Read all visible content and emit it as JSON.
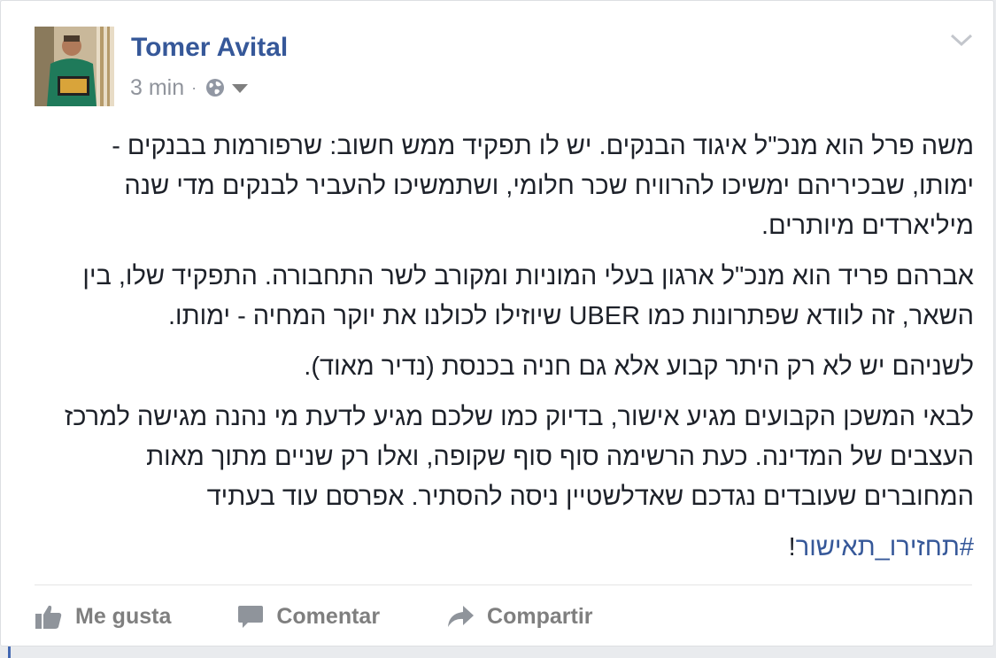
{
  "post": {
    "author": "Tomer Avital",
    "time": "3 min",
    "separator": "·",
    "paragraphs": [
      "משה פרל הוא מנכ\"ל איגוד הבנקים. יש לו תפקיד ממש חשוב: שרפורמות בבנקים - ימותו, שבכיריהם ימשיכו להרוויח שכר חלומי, ושתמשיכו להעביר לבנקים מדי שנה מיליארדים מיותרים.",
      "אברהם פריד הוא מנכ\"ל ארגון בעלי המוניות ומקורב לשר התחבורה. התפקיד שלו, בין השאר, זה לוודא שפתרונות כמו UBER שיוזילו לכולנו את יוקר המחיה - ימותו.",
      "לשניהם יש לא רק היתר קבוע אלא גם חניה בכנסת (נדיר מאוד).",
      "לבאי המשכן הקבועים מגיע אישור, בדיוק כמו שלכם מגיע לדעת מי נהנה מגישה למרכז העצבים של המדינה. כעת הרשימה סוף סוף שקופה, ואלו רק שניים מתוך מאות המחוברים שעובדים נגדכם שאדלשטיין ניסה להסתיר. אפרסם עוד בעתיד"
    ],
    "hashtag": "#תחזירו_תאישור",
    "hashtag_suffix": "!"
  },
  "actions": {
    "like": "Me gusta",
    "comment": "Comentar",
    "share": "Compartir"
  },
  "icons": {
    "audience": "globe-icon",
    "audience_menu": "caret-down-icon",
    "post_menu": "chevron-down-icon",
    "like": "thumbs-up-icon",
    "comment": "speech-bubble-icon",
    "share": "share-arrow-icon"
  },
  "colors": {
    "author_link": "#365899",
    "hashtag": "#365899",
    "body_text": "#1d2129",
    "meta_text": "#90949c",
    "action_text": "#7f7f7f",
    "page_background": "#e9ebee"
  }
}
